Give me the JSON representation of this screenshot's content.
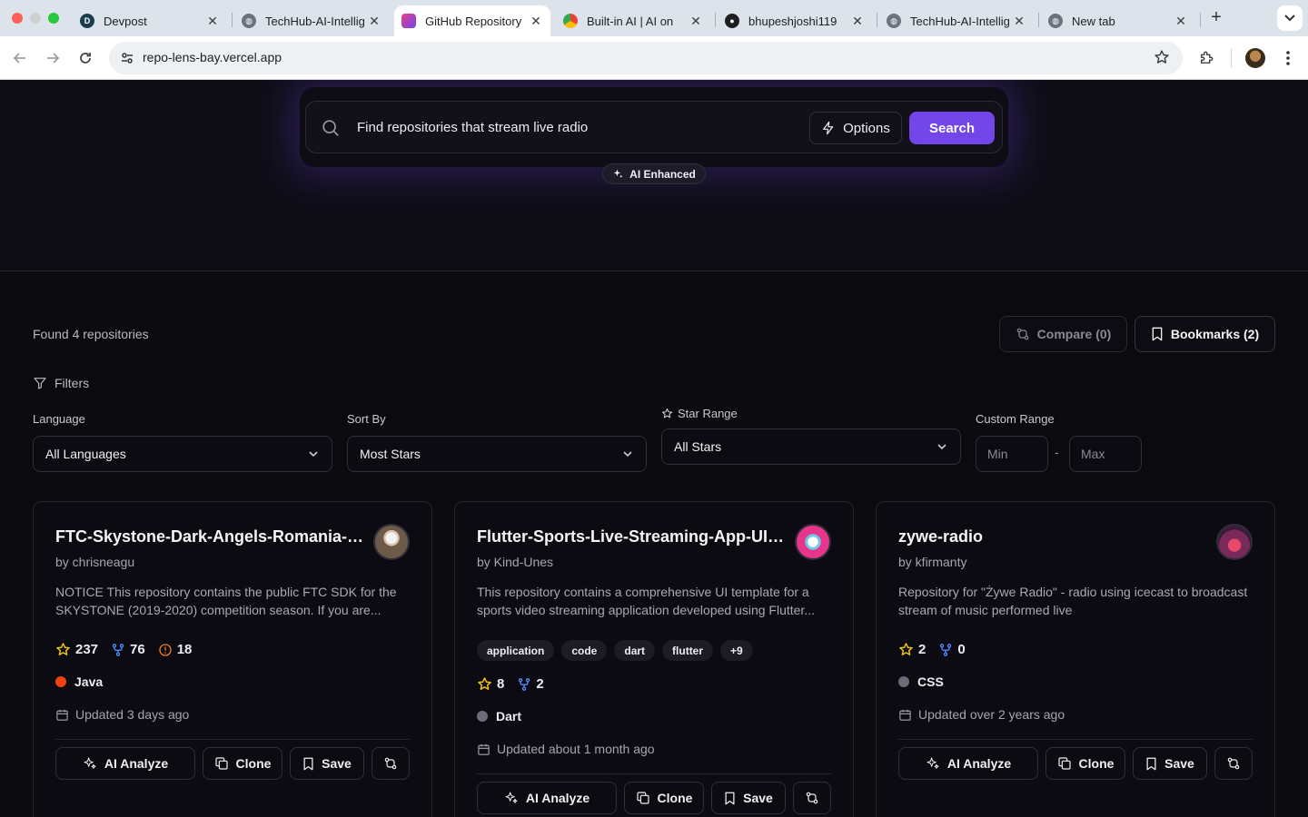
{
  "browser": {
    "tabs": [
      {
        "title": "Devpost",
        "active": false
      },
      {
        "title": "TechHub-AI-Intellig",
        "active": false
      },
      {
        "title": "GitHub Repository",
        "active": true
      },
      {
        "title": "Built-in AI | AI on",
        "active": false
      },
      {
        "title": "bhupeshjoshi119",
        "active": false
      },
      {
        "title": "TechHub-AI-Intellig",
        "active": false
      },
      {
        "title": "New tab",
        "active": false
      }
    ],
    "url": "repo-lens-bay.vercel.app"
  },
  "search": {
    "query": "Find repositories that stream live radio",
    "options_label": "Options",
    "search_label": "Search",
    "ai_badge": "AI Enhanced"
  },
  "results": {
    "found_text": "Found 4 repositories",
    "compare_label": "Compare (0)",
    "bookmarks_label": "Bookmarks (2)"
  },
  "filters": {
    "title": "Filters",
    "language_label": "Language",
    "language_value": "All Languages",
    "sort_label": "Sort By",
    "sort_value": "Most Stars",
    "star_range_label": "Star Range",
    "star_range_value": "All Stars",
    "custom_range_label": "Custom Range",
    "min_placeholder": "Min",
    "max_placeholder": "Max",
    "range_separator": "-"
  },
  "cards": [
    {
      "title": "FTC-Skystone-Dark-Angels-Romania-2...",
      "owner": "by chrisneagu",
      "description": "NOTICE This repository contains the public FTC SDK for the SKYSTONE (2019-2020) competition season. If you are...",
      "tags": [],
      "stars": "237",
      "forks": "76",
      "issues": "18",
      "language": "Java",
      "language_color": "#f0420f",
      "updated": "Updated 3 days ago"
    },
    {
      "title": "Flutter-Sports-Live-Streaming-App-UI-T...",
      "owner": "by Kind-Unes",
      "description": "This repository contains a comprehensive UI template for a sports video streaming application developed using Flutter...",
      "tags": [
        "application",
        "code",
        "dart",
        "flutter",
        "+9"
      ],
      "stars": "8",
      "forks": "2",
      "language": "Dart",
      "language_color": "#6c6c78",
      "updated": "Updated about 1 month ago"
    },
    {
      "title": "zywe-radio",
      "owner": "by kfirmanty",
      "description": "Repository for \"Żywe Radio\" - radio using icecast to broadcast stream of music performed live",
      "tags": [],
      "stars": "2",
      "forks": "0",
      "language": "CSS",
      "language_color": "#6c6c78",
      "updated": "Updated over 2 years ago"
    }
  ],
  "card_actions": {
    "analyze": "AI Analyze",
    "clone": "Clone",
    "save": "Save"
  },
  "colors": {
    "accent": "#7246e8",
    "star": "#f5c518",
    "fork": "#4c8dff",
    "issue": "#f07a26"
  }
}
